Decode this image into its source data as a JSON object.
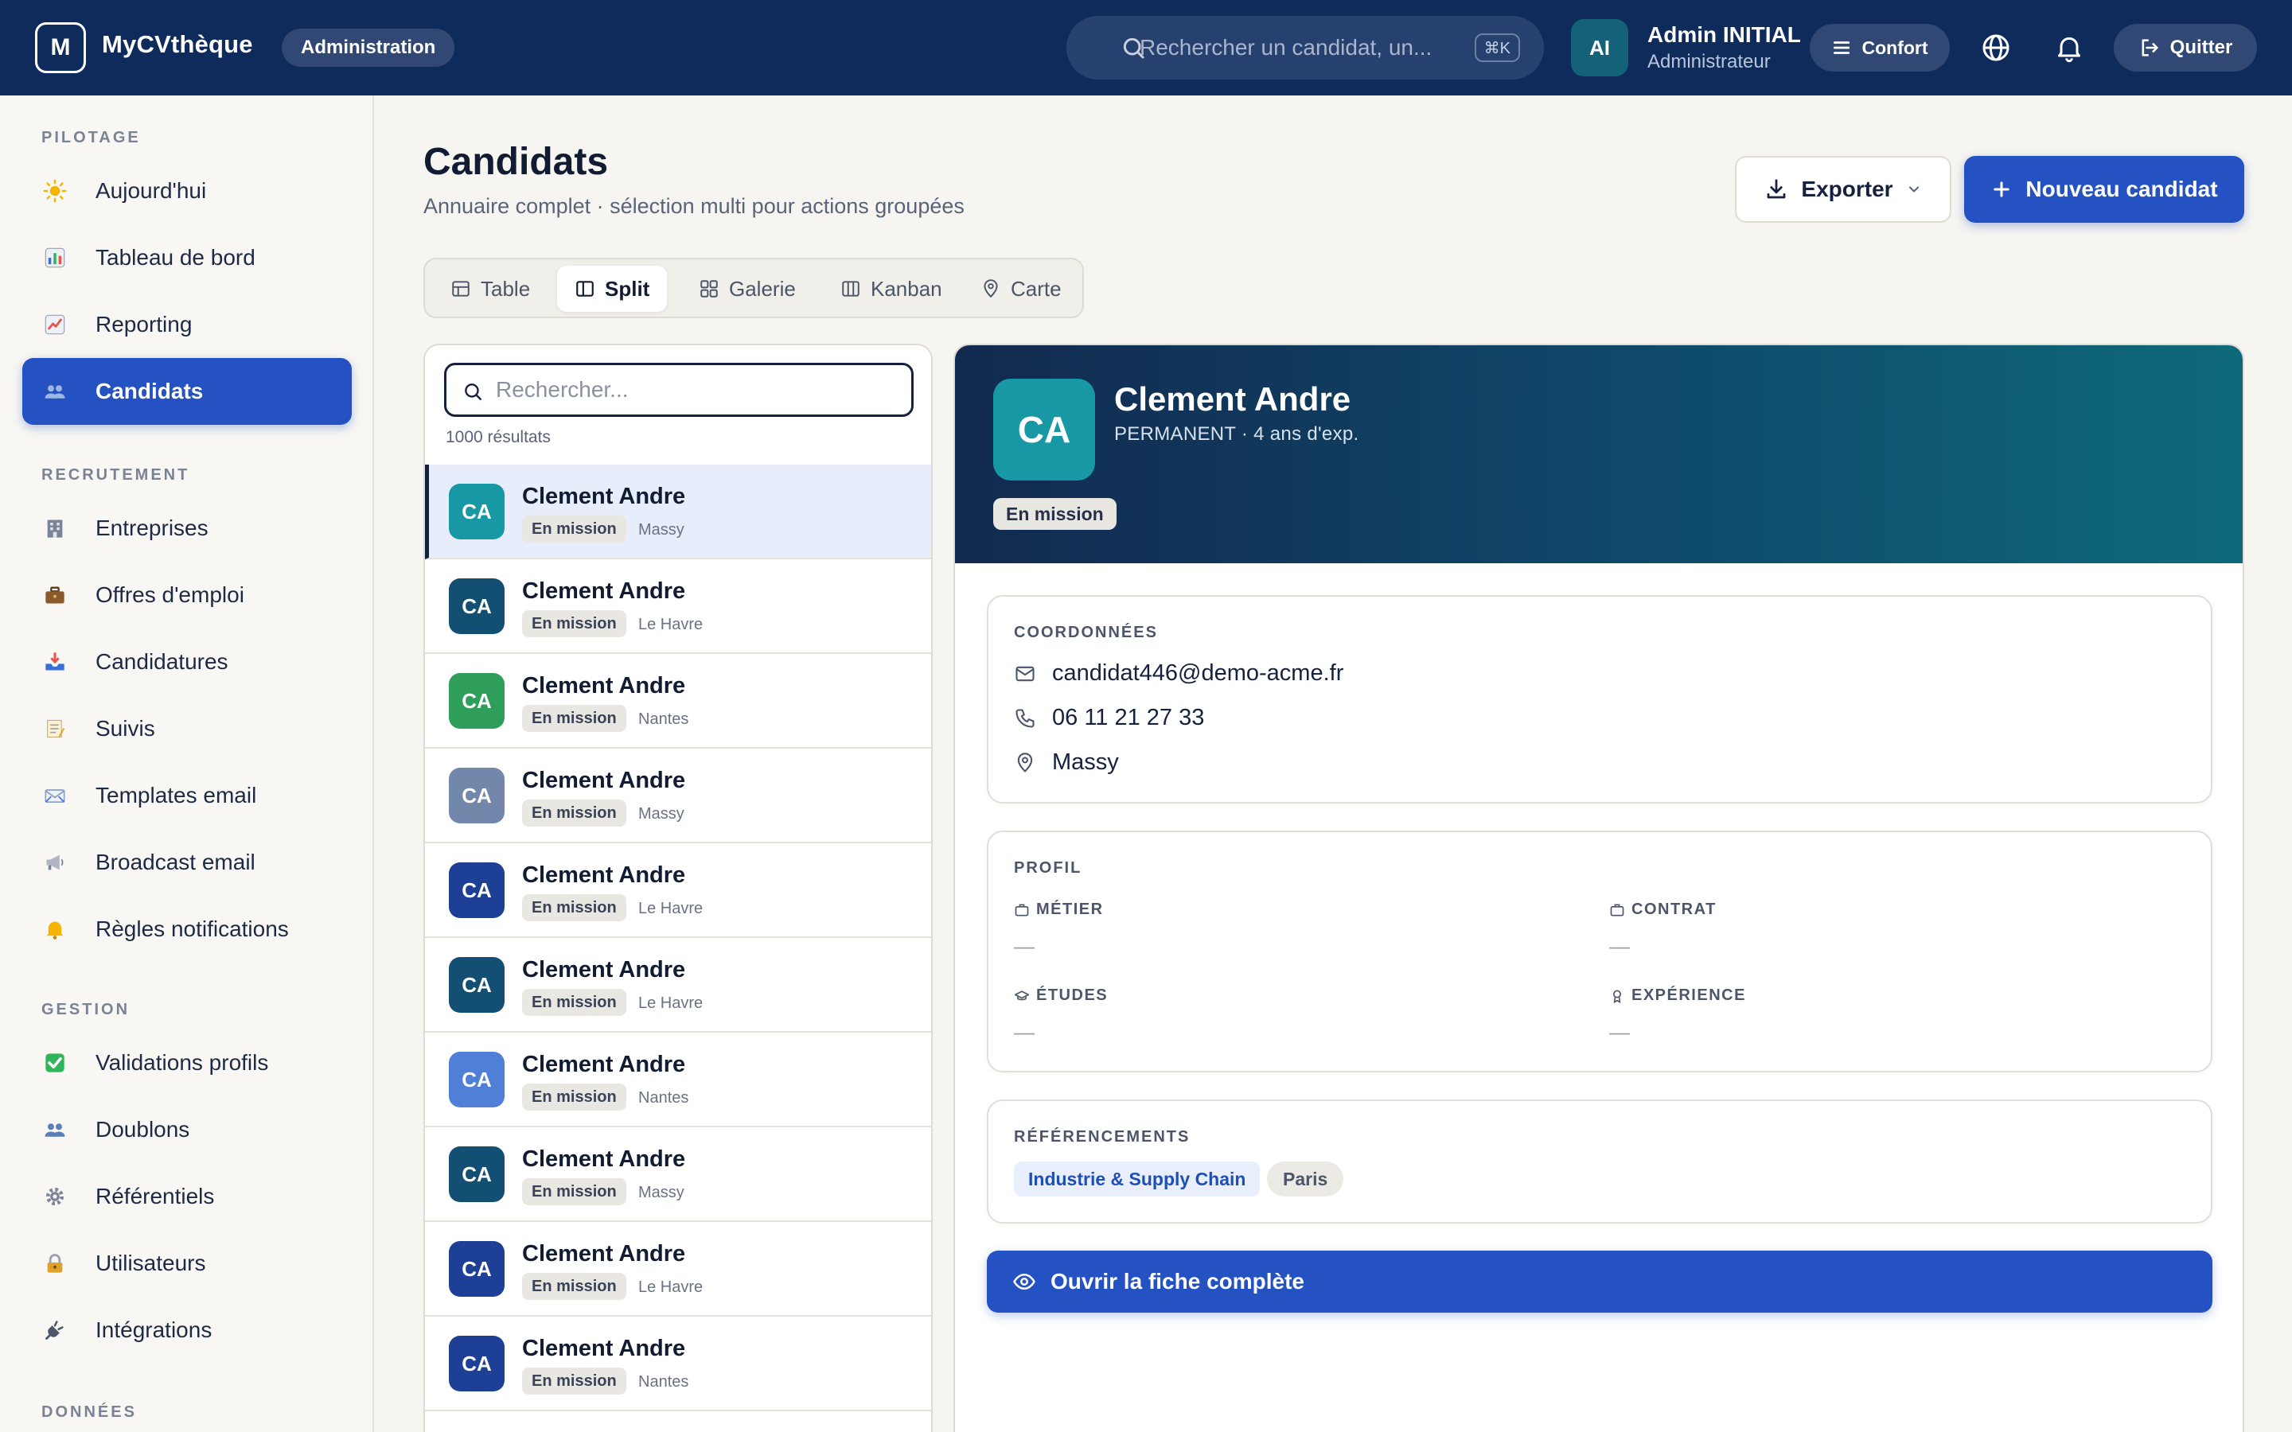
{
  "topbar": {
    "logo_letter": "M",
    "brand": "MyCVthèque",
    "context": "Administration",
    "search_placeholder": "Rechercher un candidat, un...",
    "shortcut": "⌘K",
    "user_initials": "AI",
    "user_name": "Admin INITIAL",
    "user_role": "Administrateur",
    "comfort_label": "Confort",
    "quit_label": "Quitter"
  },
  "sidebar": {
    "sections": [
      {
        "label": "PILOTAGE",
        "items": [
          {
            "label": "Aujourd'hui",
            "icon": "sun-icon",
            "color": "#f5b400"
          },
          {
            "label": "Tableau de bord",
            "icon": "bar-chart-icon",
            "color": "#3b6fd8"
          },
          {
            "label": "Reporting",
            "icon": "chart-up-icon",
            "color": "#e4574c"
          },
          {
            "label": "Candidats",
            "icon": "people-icon",
            "color": "#5b7fb8",
            "active": true
          }
        ]
      },
      {
        "label": "RECRUTEMENT",
        "items": [
          {
            "label": "Entreprises",
            "icon": "office-building-icon",
            "color": "#7a8496"
          },
          {
            "label": "Offres d'emploi",
            "icon": "briefcase-icon",
            "color": "#8a5a2b"
          },
          {
            "label": "Candidatures",
            "icon": "inbox-tray-icon",
            "color": "#e4574c"
          },
          {
            "label": "Suivis",
            "icon": "memo-icon",
            "color": "#e8c76a"
          },
          {
            "label": "Templates email",
            "icon": "envelope-icon",
            "color": "#8aa0c4"
          },
          {
            "label": "Broadcast email",
            "icon": "megaphone-icon",
            "color": "#9aa1ad"
          },
          {
            "label": "Règles notifications",
            "icon": "bell-icon",
            "color": "#f5b400"
          }
        ]
      },
      {
        "label": "GESTION",
        "items": [
          {
            "label": "Validations profils",
            "icon": "check-box-icon",
            "color": "#2fb55a"
          },
          {
            "label": "Doublons",
            "icon": "people-icon",
            "color": "#5b7fb8"
          },
          {
            "label": "Référentiels",
            "icon": "gear-icon",
            "color": "#7a8496"
          },
          {
            "label": "Utilisateurs",
            "icon": "lock-key-icon",
            "color": "#e0a12a"
          },
          {
            "label": "Intégrations",
            "icon": "plug-icon",
            "color": "#4c5569"
          }
        ]
      },
      {
        "label": "DONNÉES",
        "items": []
      }
    ]
  },
  "page": {
    "title": "Candidats",
    "subtitle": "Annuaire complet · sélection multi pour actions groupées",
    "export_label": "Exporter",
    "new_label": "Nouveau candidat"
  },
  "views": [
    {
      "label": "Table",
      "icon": "table-icon"
    },
    {
      "label": "Split",
      "icon": "split-panel-icon",
      "active": true
    },
    {
      "label": "Galerie",
      "icon": "grid-icon"
    },
    {
      "label": "Kanban",
      "icon": "kanban-icon"
    },
    {
      "label": "Carte",
      "icon": "map-pin-icon"
    }
  ],
  "list": {
    "search_placeholder": "Rechercher...",
    "result_count": "1000 résultats",
    "rows": [
      {
        "initials": "CA",
        "name": "Clement Andre",
        "status": "En mission",
        "city": "Massy",
        "color": "#1898a4",
        "selected": true
      },
      {
        "initials": "CA",
        "name": "Clement Andre",
        "status": "En mission",
        "city": "Le Havre",
        "color": "#134f72"
      },
      {
        "initials": "CA",
        "name": "Clement Andre",
        "status": "En mission",
        "city": "Nantes",
        "color": "#2f9e5a"
      },
      {
        "initials": "CA",
        "name": "Clement Andre",
        "status": "En mission",
        "city": "Massy",
        "color": "#7287a9"
      },
      {
        "initials": "CA",
        "name": "Clement Andre",
        "status": "En mission",
        "city": "Le Havre",
        "color": "#1d3f95"
      },
      {
        "initials": "CA",
        "name": "Clement Andre",
        "status": "En mission",
        "city": "Le Havre",
        "color": "#134f72"
      },
      {
        "initials": "CA",
        "name": "Clement Andre",
        "status": "En mission",
        "city": "Nantes",
        "color": "#4f7fd6"
      },
      {
        "initials": "CA",
        "name": "Clement Andre",
        "status": "En mission",
        "city": "Massy",
        "color": "#134f72"
      },
      {
        "initials": "CA",
        "name": "Clement Andre",
        "status": "En mission",
        "city": "Le Havre",
        "color": "#1d3f95"
      },
      {
        "initials": "CA",
        "name": "Clement Andre",
        "status": "En mission",
        "city": "Nantes",
        "color": "#1d3f95"
      }
    ]
  },
  "detail": {
    "initials": "CA",
    "name": "Clement Andre",
    "meta": "PERMANENT · 4 ans d'exp.",
    "status": "En mission",
    "contact_title": "COORDONNÉES",
    "email": "candidat446@demo-acme.fr",
    "phone": "06 11 21 27 33",
    "city": "Massy",
    "profile_title": "PROFIL",
    "metier_label": "MÉTIER",
    "metier_value": "—",
    "contrat_label": "CONTRAT",
    "contrat_value": "—",
    "etudes_label": "ÉTUDES",
    "etudes_value": "—",
    "experience_label": "EXPÉRIENCE",
    "experience_value": "—",
    "refs_title": "RÉFÉRENCEMENTS",
    "ref_sector": "Industrie & Supply Chain",
    "ref_city": "Paris",
    "open_label": "Ouvrir la fiche complète"
  },
  "colors": {
    "topbar": "#0f2b5c",
    "accent": "#2452c3",
    "background": "#f6f5f1"
  }
}
